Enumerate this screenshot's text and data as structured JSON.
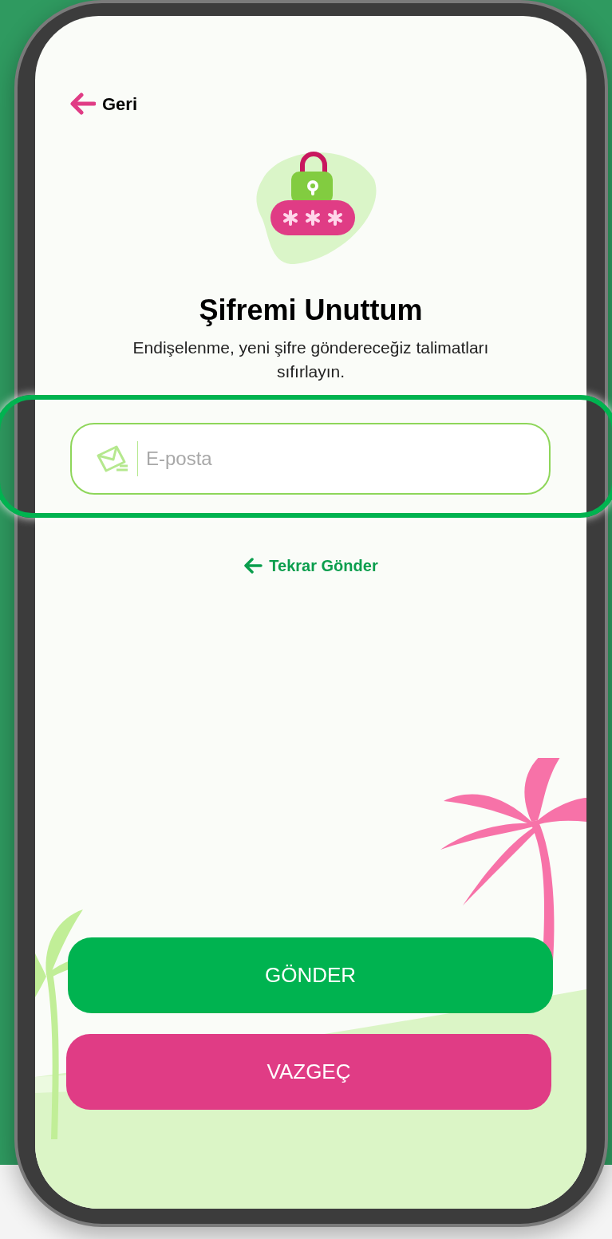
{
  "back_link": {
    "label": "Geri"
  },
  "title": "Şifremi Unuttum",
  "subtitle": "Endişelenme, yeni şifre göndereceğiz talimatları sıfırlayın.",
  "email_field": {
    "placeholder": "E-posta"
  },
  "resend_link": {
    "label": "Tekrar Gönder"
  },
  "buttons": [
    {
      "kind": "submit",
      "label": "GÖNDER"
    },
    {
      "kind": "cancel",
      "label": "VAZGEÇ"
    }
  ]
}
